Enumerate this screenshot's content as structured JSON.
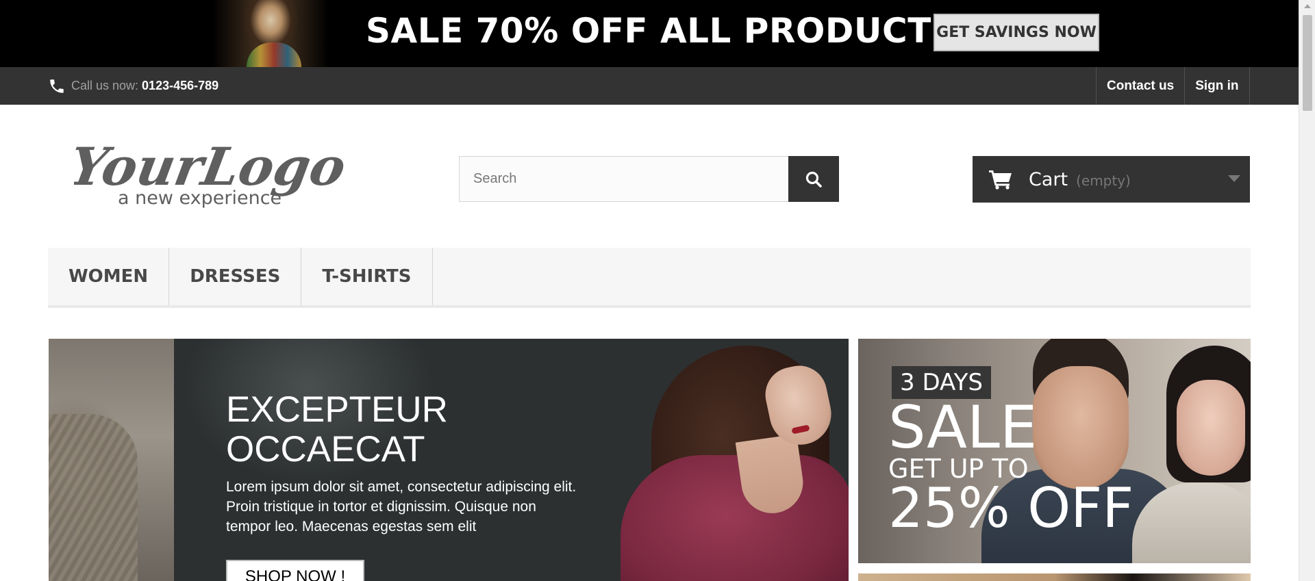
{
  "promo": {
    "headline": "SALE 70% OFF ALL PRODUCTS",
    "button_label": "GET SAVINGS NOW"
  },
  "topbar": {
    "phone_prefix": "Call us now:",
    "phone_number": "0123-456-789",
    "links": [
      "Contact us",
      "Sign in"
    ]
  },
  "header": {
    "logo_main": "YourLogo",
    "logo_tagline": "a new experience",
    "search_placeholder": "Search",
    "cart_label": "Cart",
    "cart_status": "(empty)"
  },
  "menu": {
    "items": [
      "WOMEN",
      "DRESSES",
      "T-SHIRTS"
    ]
  },
  "hero": {
    "title": "EXCEPTEUR OCCAECAT",
    "text": "Lorem ipsum dolor sit amet, consectetur adipiscing elit. Proin tristique in tortor et dignissim. Quisque non tempor leo. Maecenas egestas sem elit",
    "button_label": "SHOP NOW !"
  },
  "side_banner": {
    "days": "3 DAYS",
    "sale": "SALE",
    "get_up_to": "GET UP TO",
    "discount": "25% OFF"
  },
  "icons": {
    "phone": "phone-icon",
    "search": "search-icon",
    "cart": "cart-icon",
    "caret": "caret-down-icon"
  },
  "colors": {
    "dark": "#333333",
    "promo_bg": "#000000",
    "menu_bg": "#f6f6f6"
  }
}
